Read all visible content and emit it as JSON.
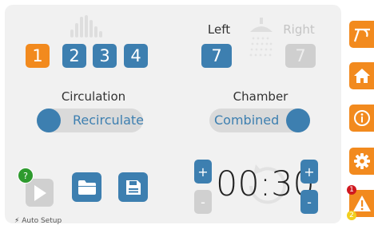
{
  "pumps": {
    "buttons": [
      {
        "label": "1",
        "state": "active"
      },
      {
        "label": "2",
        "state": "normal"
      },
      {
        "label": "3",
        "state": "normal"
      },
      {
        "label": "4",
        "state": "normal"
      }
    ]
  },
  "sides": {
    "left_label": "Left",
    "right_label": "Right",
    "left_value": "7",
    "right_value": "7"
  },
  "circulation": {
    "title": "Circulation",
    "value": "Recirculate"
  },
  "chamber": {
    "title": "Chamber",
    "value": "Combined"
  },
  "timer": {
    "value": "00:30",
    "plus_label": "+",
    "minus_label": "-"
  },
  "badges": {
    "play": "?",
    "alert_primary": "1",
    "alert_secondary": "2"
  },
  "status": {
    "text": "Auto Setup"
  },
  "colors": {
    "accent": "#f28a1e",
    "primary": "#3d7fb0",
    "disabled": "#d0d0d0",
    "help_badge": "#2e9a2e",
    "alert_badge": "#d0181f",
    "warn_badge": "#f2cf1e"
  }
}
